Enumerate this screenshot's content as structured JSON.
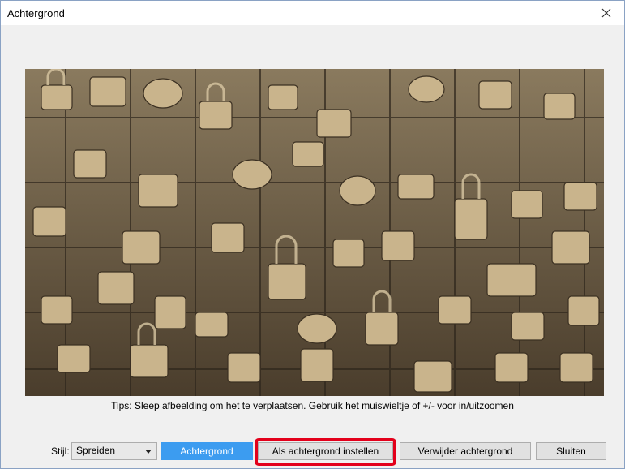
{
  "window": {
    "title": "Achtergrond",
    "close_icon": "close-icon"
  },
  "preview": {
    "description_icon": "love-locks-photo"
  },
  "tips": "Tips: Sleep afbeelding om het te verplaatsen. Gebruik het muiswieltje of +/- voor in/uitzoomen",
  "bottom": {
    "style_label": "Stijl:",
    "style_value": "Spreiden",
    "background_button": "Achtergrond",
    "set_background_button": "Als achtergrond instellen",
    "remove_background_button": "Verwijder achtergrond",
    "close_button": "Sluiten"
  },
  "colors": {
    "accent": "#3c9cf0",
    "highlight": "#e3001b"
  }
}
